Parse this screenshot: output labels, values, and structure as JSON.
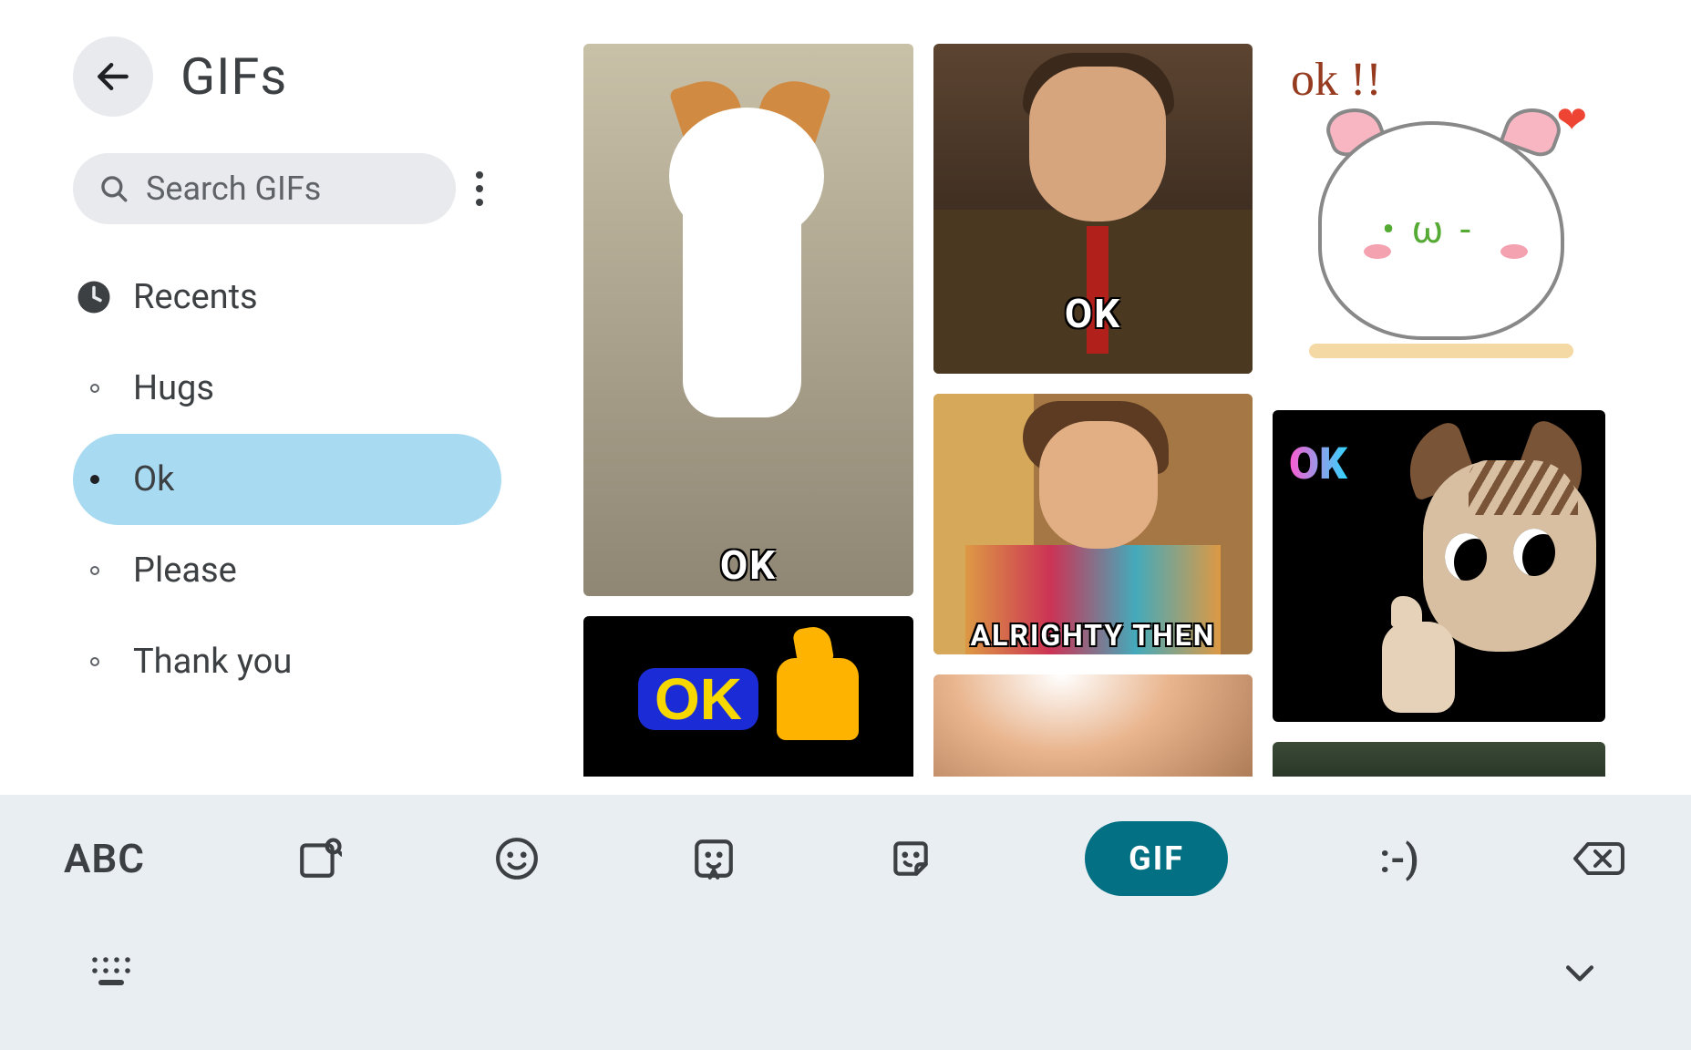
{
  "header": {
    "title": "GIFs"
  },
  "search": {
    "placeholder": "Search GIFs"
  },
  "categories": [
    {
      "id": "recents",
      "label": "Recents",
      "icon": "clock",
      "selected": false
    },
    {
      "id": "hugs",
      "label": "Hugs",
      "icon": "dot",
      "selected": false
    },
    {
      "id": "ok",
      "label": "Ok",
      "icon": "dot",
      "selected": true
    },
    {
      "id": "please",
      "label": "Please",
      "icon": "dot",
      "selected": false
    },
    {
      "id": "thankyou",
      "label": "Thank you",
      "icon": "dot",
      "selected": false
    }
  ],
  "gifs": {
    "col1": [
      {
        "id": "cat-standing-ok",
        "caption": "OK"
      },
      {
        "id": "ok-thumbs-up-neon",
        "bubble_text": "OK"
      }
    ],
    "col2": [
      {
        "id": "mr-bean-thumbs-up",
        "caption": "OK"
      },
      {
        "id": "ace-ventura-alrighty",
        "caption": "ALRIGHTY THEN"
      },
      {
        "id": "forehead-closeup"
      }
    ],
    "col3": [
      {
        "id": "kawaii-cat-ok",
        "overlay": "ok !!"
      },
      {
        "id": "sad-cat-thumbs-up",
        "overlay": "OK"
      },
      {
        "id": "green-cropped"
      }
    ]
  },
  "toolbar": {
    "abc": "ABC",
    "gif": "GIF",
    "emoticon": ":-)"
  }
}
